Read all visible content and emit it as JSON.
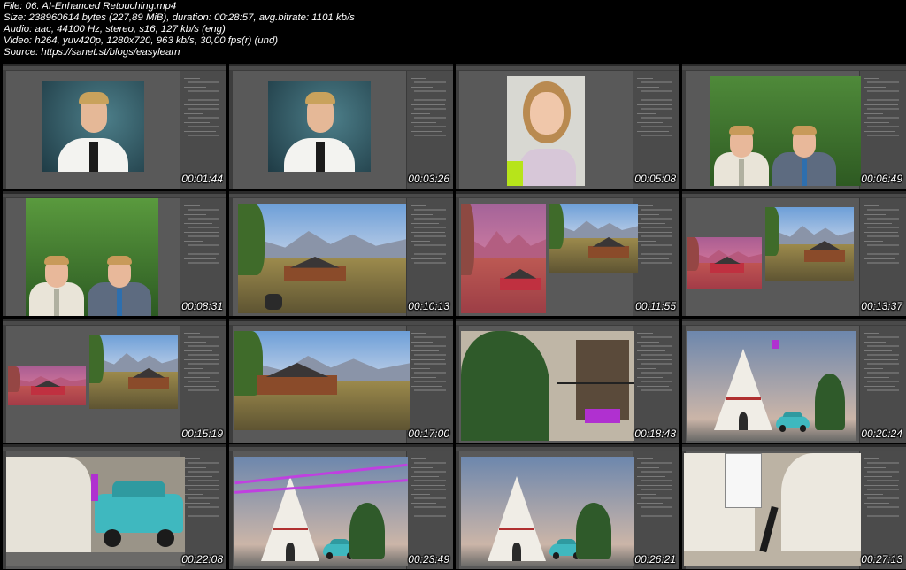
{
  "header": {
    "file": "File: 06. AI-Enhanced Retouching.mp4",
    "size": "Size: 238960614 bytes (227,89 MiB), duration: 00:28:57, avg.bitrate: 1101 kb/s",
    "audio": "Audio: aac, 44100 Hz, stereo, s16, 127 kb/s (eng)",
    "video": "Video: h264, yuv420p, 1280x720, 963 kb/s, 30,00 fps(r) (und)",
    "source": "Source: https://sanet.st/blogs/easylearn"
  },
  "thumbnails": [
    {
      "timestamp": "00:01:44",
      "scene": "portrait-teal"
    },
    {
      "timestamp": "00:03:26",
      "scene": "portrait-teal"
    },
    {
      "timestamp": "00:05:08",
      "scene": "girl"
    },
    {
      "timestamp": "00:06:49",
      "scene": "two-men"
    },
    {
      "timestamp": "00:08:31",
      "scene": "two-men-wide"
    },
    {
      "timestamp": "00:10:13",
      "scene": "barn"
    },
    {
      "timestamp": "00:11:55",
      "scene": "barn-split"
    },
    {
      "timestamp": "00:13:37",
      "scene": "barn-split2"
    },
    {
      "timestamp": "00:15:19",
      "scene": "barn-split3"
    },
    {
      "timestamp": "00:17:00",
      "scene": "barn-zoom"
    },
    {
      "timestamp": "00:18:43",
      "scene": "tree-house"
    },
    {
      "timestamp": "00:20:24",
      "scene": "teepee"
    },
    {
      "timestamp": "00:22:08",
      "scene": "car-closeup"
    },
    {
      "timestamp": "00:23:49",
      "scene": "teepee-lines"
    },
    {
      "timestamp": "00:26:21",
      "scene": "teepee-clean"
    },
    {
      "timestamp": "00:27:13",
      "scene": "dancer"
    }
  ]
}
